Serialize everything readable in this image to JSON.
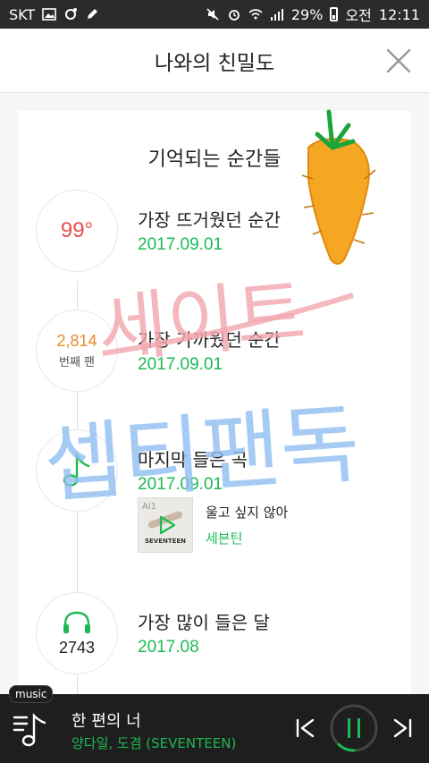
{
  "status_bar": {
    "carrier": "SKT",
    "battery": "29%",
    "ampm": "오전",
    "time": "12:11"
  },
  "header": {
    "title": "나와의 친밀도"
  },
  "section": {
    "title": "기억되는 순간들"
  },
  "moments": [
    {
      "badge": "99°",
      "label": "가장 뜨거웠던 순간",
      "date": "2017.09.01"
    },
    {
      "badge": "2,814",
      "badge_sub": "번째 팬",
      "label": "가장 가까웠던 순간",
      "date": "2017.09.01"
    },
    {
      "label": "마지막 들은 곡",
      "date": "2017.09.01"
    },
    {
      "badge": "2743",
      "label": "가장 많이 들은 달",
      "date": "2017.08"
    }
  ],
  "last_song": {
    "title": "울고 싶지 않아",
    "artist": "세븐틴",
    "album_text": "SEVENTEEN",
    "album_mark": "Al1"
  },
  "graffiti": {
    "line1": "세이트",
    "line2": "셉티팬독"
  },
  "player": {
    "tag": "music",
    "track_title": "한 편의 너",
    "track_artist": "양다일, 도겸 (SEVENTEEN)",
    "progress": 0.12
  },
  "colors": {
    "accent_green": "#1db954",
    "temp_red": "#e94c4c",
    "fan_orange": "#e88b2a"
  }
}
